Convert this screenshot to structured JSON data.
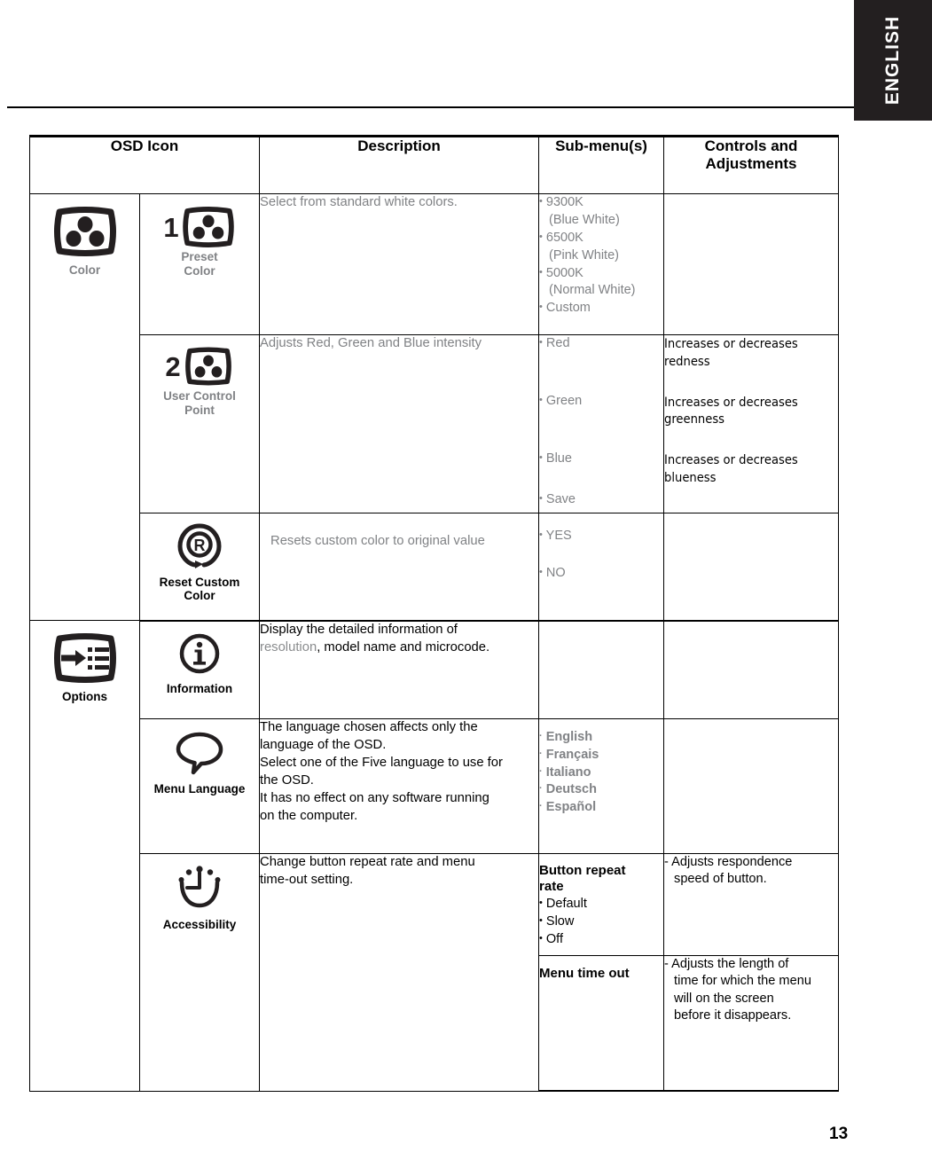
{
  "page": {
    "language_tab": "ENGLISH",
    "page_number": "13"
  },
  "table": {
    "headers": {
      "osd_icon": "OSD Icon",
      "description": "Description",
      "sub_menus": "Sub-menu(s)",
      "controls": "Controls and Adjustments"
    },
    "groups": [
      {
        "name": "Color",
        "icon": "color-monitor-icon",
        "rows": [
          {
            "number": "1",
            "label_line1": "Preset",
            "label_line2": "Color",
            "icon": "preset-color-icon",
            "description": "Select from standard white colors.",
            "sub_menu": [
              {
                "bullet": "•",
                "text": "9300K",
                "sub": "(Blue White)"
              },
              {
                "bullet": "•",
                "text": "6500K",
                "sub": "(Pink White)"
              },
              {
                "bullet": "•",
                "text": "5000K",
                "sub": "(Normal White)"
              },
              {
                "bullet": "•",
                "text": "Custom",
                "sub": ""
              }
            ],
            "controls": []
          },
          {
            "number": "2",
            "label_line1": "User Control",
            "label_line2": "Point",
            "icon": "user-control-point-icon",
            "description": "Adjusts Red, Green and Blue intensity",
            "sub_menu": [
              {
                "bullet": "•",
                "text": "Red",
                "sub": ""
              },
              {
                "bullet": "•",
                "text": "Green",
                "sub": ""
              },
              {
                "bullet": "•",
                "text": "Blue",
                "sub": ""
              },
              {
                "bullet": "•",
                "text": "Save",
                "sub": ""
              }
            ],
            "controls": [
              "Increases or decreases redness",
              "Increases or decreases greenness",
              "Increases or decreases blueness"
            ]
          },
          {
            "number": "",
            "label_line1": "Reset Custom",
            "label_line2": "Color",
            "icon": "reset-custom-color-icon",
            "description": "Resets custom color to original value",
            "sub_menu": [
              {
                "bullet": "•",
                "text": "YES",
                "sub": ""
              },
              {
                "bullet": "•",
                "text": "NO",
                "sub": ""
              }
            ],
            "controls": []
          }
        ]
      },
      {
        "name": "Options",
        "icon": "options-monitor-icon",
        "rows": [
          {
            "number": "",
            "label_line1": "Information",
            "label_line2": "",
            "icon": "information-icon",
            "description_line1": "Display the detailed information of",
            "description_gray": "resolution",
            "description_line2": ", model name and microcode.",
            "sub_menu": [],
            "controls": []
          },
          {
            "number": "",
            "label_line1": "Menu Language",
            "label_line2": "",
            "icon": "speech-bubble-icon",
            "description_lines": [
              "The language chosen affects only the",
              "language of the OSD.",
              "Select one of the Five language to use for",
              "the OSD.",
              "It has no effect on any software running",
              "on the computer."
            ],
            "sub_menu": [
              {
                "bullet": "·",
                "text": "English"
              },
              {
                "bullet": "·",
                "text": "Français"
              },
              {
                "bullet": "·",
                "text": "Italiano"
              },
              {
                "bullet": "·",
                "text": "Deutsch"
              },
              {
                "bullet": "·",
                "text": "Español"
              }
            ],
            "controls": []
          },
          {
            "number": "",
            "label_line1": "Accessibility",
            "label_line2": "",
            "icon": "accessibility-clock-icon",
            "description_lines": [
              "Change button repeat rate and menu",
              "time-out setting."
            ],
            "sub_blocks": [
              {
                "heading_line1": "Button repeat",
                "heading_line2": "rate",
                "items": [
                  {
                    "bullet": "•",
                    "text": "Default"
                  },
                  {
                    "bullet": "•",
                    "text": "Slow"
                  },
                  {
                    "bullet": "•",
                    "text": "Off"
                  }
                ],
                "controls_lines": [
                  "- Adjusts respondence",
                  "speed of button."
                ]
              },
              {
                "heading_line1": "Menu time out",
                "heading_line2": "",
                "items": [],
                "controls_lines": [
                  "- Adjusts the length of",
                  "time for which the menu",
                  "will on the screen",
                  "before it disappears."
                ]
              }
            ]
          }
        ]
      }
    ]
  }
}
